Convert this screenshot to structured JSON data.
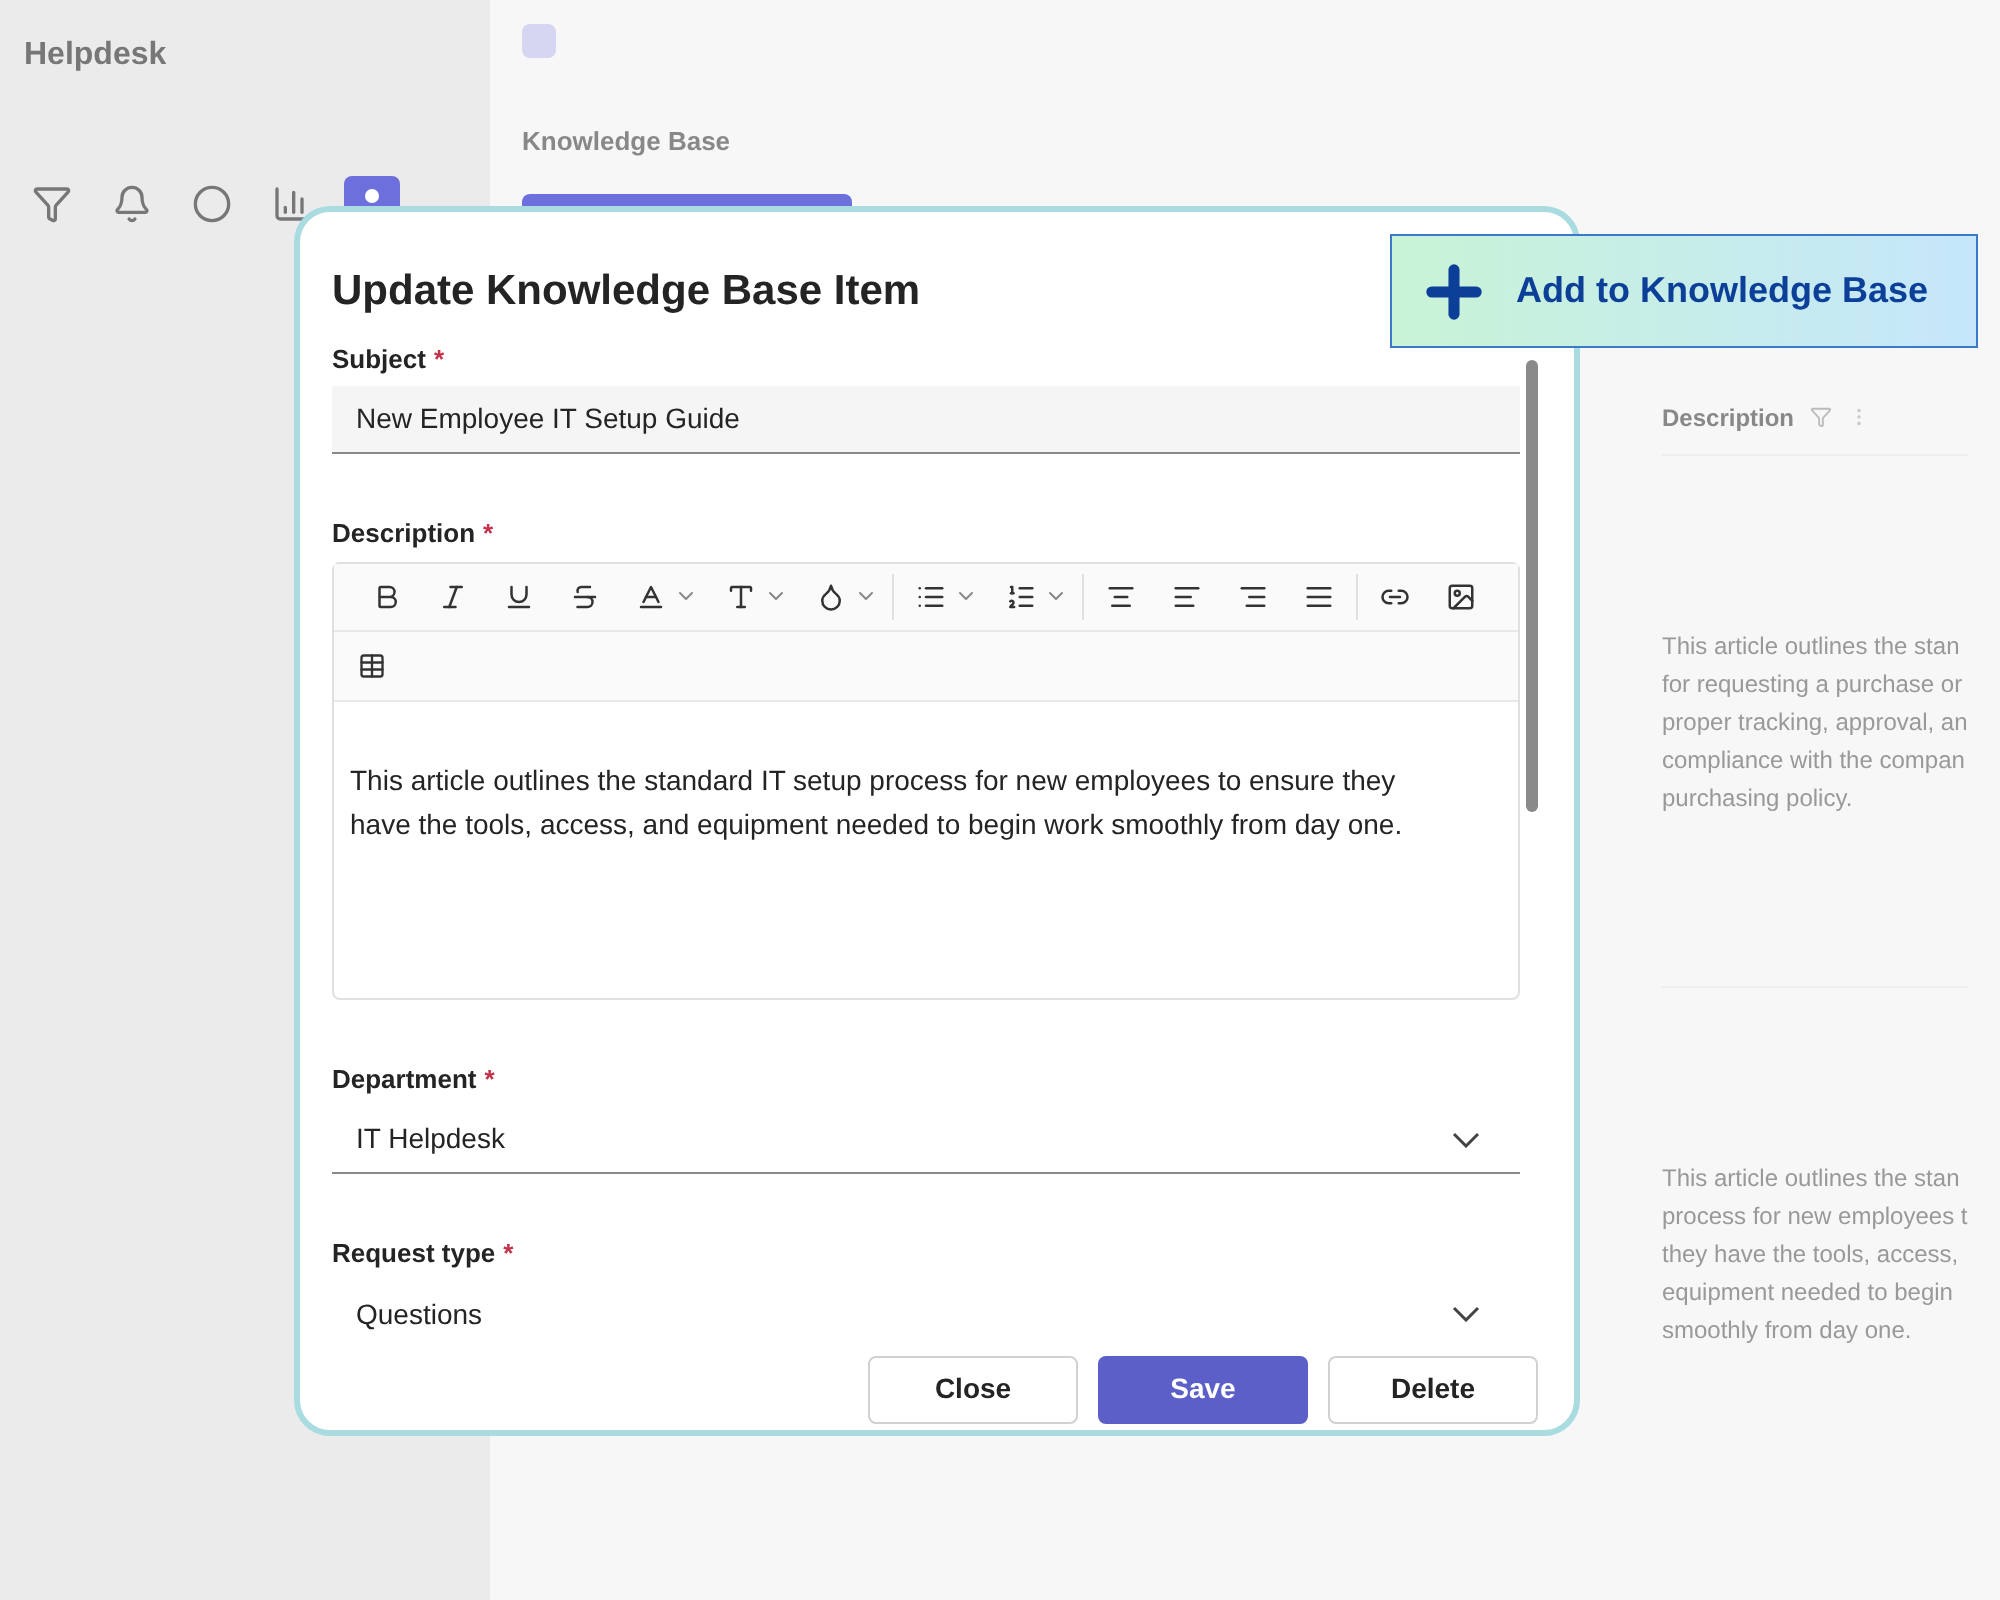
{
  "app": {
    "title": "Helpdesk"
  },
  "sidebar": {
    "items": [
      {
        "selected": false
      },
      {
        "selected": false
      },
      {
        "selected": false
      },
      {
        "selected": false
      },
      {
        "selected": true
      }
    ]
  },
  "page": {
    "heading": "Knowledge Base",
    "table": {
      "columns": [
        "Description"
      ],
      "rows": [
        {
          "description": [
            "This article outlines the stan",
            "for requesting a purchase or",
            "proper tracking, approval, an",
            "compliance with the compan",
            "purchasing policy."
          ]
        },
        {
          "description": [
            "This article outlines the stan",
            "process for new employees t",
            "they have the tools, access,",
            "equipment needed to begin",
            "smoothly from day one."
          ]
        }
      ]
    }
  },
  "dialog": {
    "title": "Update Knowledge Base Item",
    "fields": [
      {
        "kind": "text",
        "label": "Subject",
        "required_mark": "*",
        "value": "New Employee IT Setup Guide"
      },
      {
        "kind": "editor",
        "label": "Description",
        "required_mark": "*",
        "value": "This article outlines the standard IT setup process for new employees to ensure they have the tools, access, and equipment needed to begin work smoothly from day one."
      },
      {
        "kind": "select",
        "label": "Department",
        "required_mark": "*",
        "value": "IT Helpdesk"
      },
      {
        "kind": "select",
        "label": "Request type",
        "required_mark": "*",
        "value": "Questions"
      }
    ],
    "buttons": [
      {
        "label": "Close",
        "primary": false
      },
      {
        "label": "Save",
        "primary": true
      },
      {
        "label": "Delete",
        "primary": false
      }
    ]
  },
  "callout": {
    "label": "Add to Knowledge Base"
  }
}
